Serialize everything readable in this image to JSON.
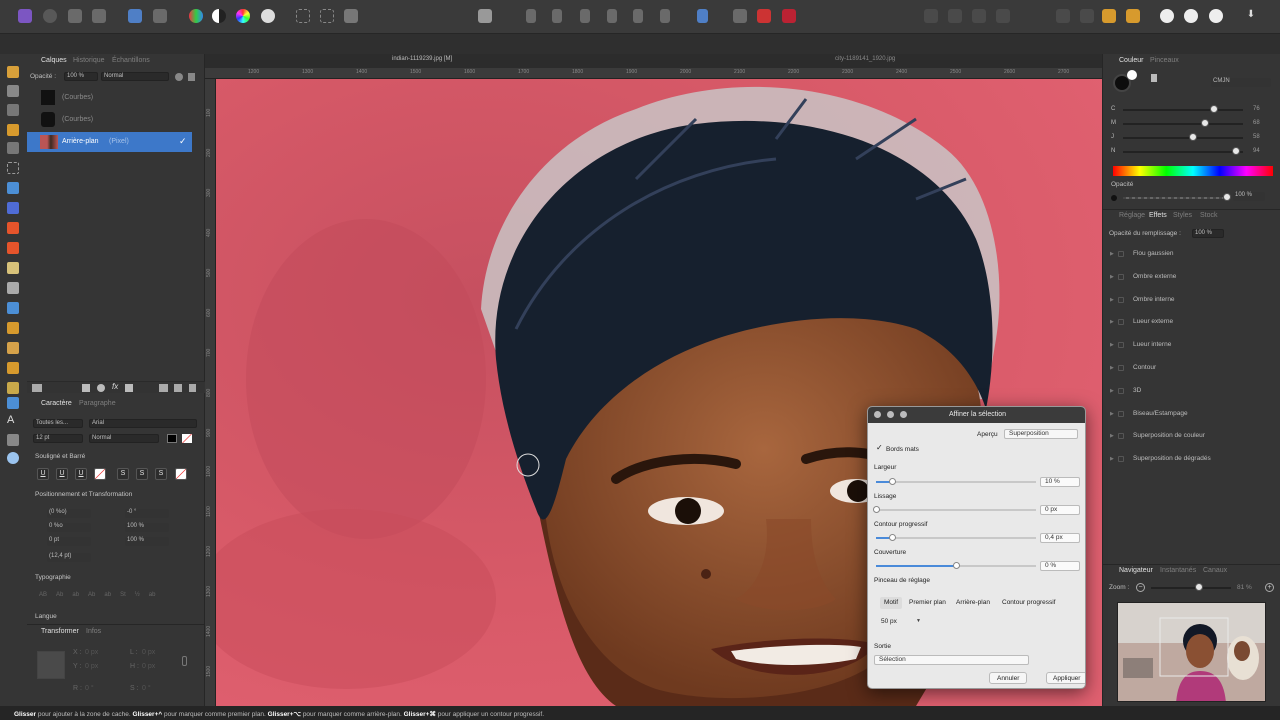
{
  "doc_tabs": {
    "left": "indian-1119239.jpg [M]",
    "right": "city-1189141_1920.jpg"
  },
  "ruler": {
    "h_ticks": [
      "1200",
      "1300",
      "1400",
      "1500",
      "1600",
      "1700",
      "1800",
      "1900",
      "2000",
      "2100",
      "2200",
      "2300",
      "2400",
      "2500",
      "2600",
      "2700"
    ],
    "v_ticks": [
      "100",
      "200",
      "300",
      "400",
      "500",
      "600",
      "700",
      "800",
      "900",
      "1000",
      "1100",
      "1200",
      "1300",
      "1400",
      "1500",
      "1600"
    ]
  },
  "layers_panel": {
    "tabs": [
      "Calques",
      "Historique",
      "Échantillons"
    ],
    "opacity_label": "Opacité :",
    "opacity_value": "100 %",
    "blend_mode": "Normal",
    "layers": [
      {
        "name": "(Courbes)",
        "type": ""
      },
      {
        "name": "(Courbes)",
        "type": ""
      },
      {
        "name": "Arrière-plan",
        "type": "(Pixel)"
      }
    ]
  },
  "character_panel": {
    "tabs": [
      "Caractère",
      "Paragraphe"
    ],
    "font_collection": "Toutes les...",
    "font_family": "Arial",
    "font_size": "12 pt",
    "font_style": "Normal",
    "underline_section": "Souligné et Barré",
    "underline_buttons": [
      "U",
      "U",
      "U",
      "S",
      "S",
      "S"
    ],
    "position_section": "Positionnement et Transformation",
    "pos_values": [
      "(0 %o)",
      "0 %o",
      "0 pt",
      "(12,4 pt)"
    ],
    "pos_values2": [
      "-0 °",
      "100 %",
      "100 %"
    ],
    "typography_section": "Typographie",
    "typography_letters": [
      "AB",
      "Ab",
      "ab",
      "Ab",
      "ab",
      "St",
      "½",
      "ab"
    ],
    "language_section": "Langue"
  },
  "transform_panel": {
    "tabs": [
      "Transformer",
      "Infos"
    ],
    "x_label": "X :",
    "x_value": "0 px",
    "y_label": "Y :",
    "y_value": "0 px",
    "w_label": "L :",
    "w_value": "0 px",
    "h_label": "H :",
    "h_value": "0 px",
    "r_label": "R :",
    "r_value": "0 °",
    "s_label": "S :",
    "s_value": "0 °"
  },
  "color_panel": {
    "tabs": [
      "Couleur",
      "Pinceaux"
    ],
    "mode": "CMJN",
    "channels": [
      {
        "label": "C",
        "value": "76",
        "position": 0.76
      },
      {
        "label": "M",
        "value": "68",
        "position": 0.68
      },
      {
        "label": "J",
        "value": "58",
        "position": 0.58
      },
      {
        "label": "N",
        "value": "94",
        "position": 0.94
      }
    ],
    "opacity_label": "Opacité",
    "opacity_value": "100 %"
  },
  "effects_panel": {
    "tabs": [
      "Réglage",
      "Effets",
      "Styles",
      "Stock"
    ],
    "fill_opacity_label": "Opacité du remplissage :",
    "fill_opacity_value": "100 %",
    "effects": [
      "Flou gaussien",
      "Ombre externe",
      "Ombre interne",
      "Lueur externe",
      "Lueur interne",
      "Contour",
      "3D",
      "Biseau/Estampage",
      "Superposition de couleur",
      "Superposition de dégradés"
    ]
  },
  "navigator_panel": {
    "tabs": [
      "Navigateur",
      "Instantanés",
      "Canaux"
    ],
    "zoom_label": "Zoom :",
    "zoom_value": "81 %",
    "zoom_position": 0.6
  },
  "refine_dialog": {
    "title": "Affiner la sélection",
    "preview_label": "Aperçu",
    "preview_value": "Superposition",
    "matte_edges_label": "Bords mats",
    "matte_edges_checked": true,
    "border_label": "Largeur",
    "border_value": "10 %",
    "border_position": 0.1,
    "smooth_label": "Lissage",
    "smooth_value": "0 px",
    "smooth_position": 0.0,
    "feather_label": "Contour progressif",
    "feather_value": "0,4 px",
    "feather_position": 0.1,
    "ramp_label": "Couverture",
    "ramp_value": "0 %",
    "ramp_position": 0.5,
    "brush_label": "Pinceau de réglage",
    "brush_modes": [
      "Motif",
      "Premier plan",
      "Arrière-plan",
      "Contour progressif"
    ],
    "brush_size": "50 px",
    "output_label": "Sortie",
    "output_value": "Sélection",
    "cancel": "Annuler",
    "apply": "Appliquer"
  },
  "status": {
    "p1": "Glisser",
    "t1": " pour ajouter à la zone de cache. ",
    "p2": "Glisser+^",
    "t2": " pour marquer comme premier plan. ",
    "p3": "Glisser+⌥",
    "t3": " pour marquer comme arrière-plan. ",
    "p4": "Glisser+⌘",
    "t4": " pour appliquer un contour progressif."
  },
  "colors": {
    "accent": "#3d78c9",
    "canvas_red": "#d8566a",
    "panel": "#353535"
  }
}
